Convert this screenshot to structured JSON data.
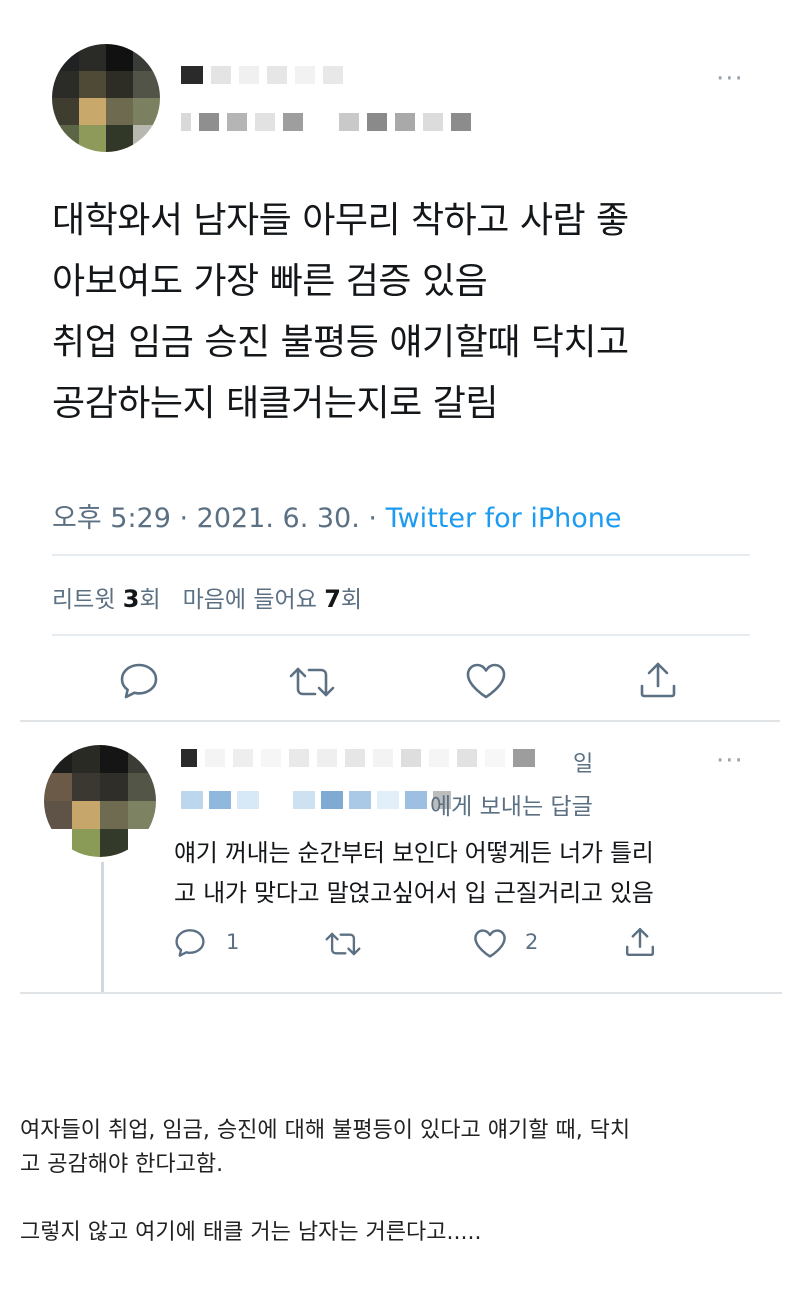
{
  "main_tweet": {
    "more_icon": "more-horizontal-icon",
    "lines": [
      "대학와서 남자들 아무리 착하고 사람 좋",
      "아보여도 가장 빠른 검증 있음",
      "취업 임금 승진 불평등 얘기할때 닥치고",
      "공감하는지 태클거는지로 갈림"
    ],
    "timestamp": "오후 5:29 · 2021. 6. 30. ·",
    "source": "Twitter for iPhone",
    "retweets_label": "리트윗",
    "retweets_count": "3",
    "retweets_unit": "회",
    "likes_label": "마음에 들어요",
    "likes_count": "7",
    "likes_unit": "회",
    "actions": [
      "reply-icon",
      "retweet-icon",
      "like-icon",
      "share-icon"
    ]
  },
  "reply": {
    "date_suffix": "일",
    "reply_to_suffix": "에게 보내는 답글",
    "lines": [
      "얘기 꺼내는 순간부터 보인다 어떻게든 너가 틀리",
      "고 내가 맞다고 말얹고싶어서 입 근질거리고 있음"
    ],
    "reply_count": "1",
    "like_count": "2",
    "more_icon": "more-horizontal-icon"
  },
  "caption": {
    "line1": "여자들이 취업, 임금, 승진에 대해 불평등이 있다고 얘기할 때, 닥치",
    "line2": "고 공감해야 한다고함.",
    "line3": "그렇지 않고 여기에 태클 거는 남자는 거른다고....."
  },
  "colors": {
    "link_blue": "#1d9bf0",
    "secondary_text": "#5b7083",
    "divider": "#e6ecf0"
  }
}
